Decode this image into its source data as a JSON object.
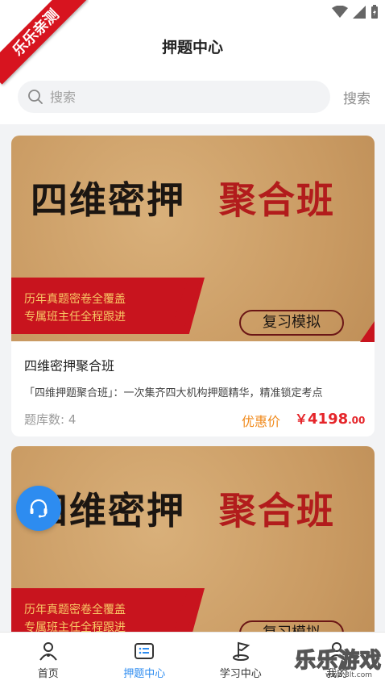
{
  "ribbon": {
    "text": "乐乐亲测"
  },
  "header": {
    "title": "押题中心"
  },
  "search": {
    "placeholder": "搜索",
    "button_label": "搜索"
  },
  "courses": [
    {
      "banner_title_a": "四维密押",
      "banner_title_b": "聚合班",
      "banner_line1": "历年真题密卷全覆盖",
      "banner_line2": "专属班主任全程跟进",
      "banner_button": "复习模拟",
      "title": "四维密押聚合班",
      "description": "「四维押题聚合班」：一次集齐四大机构押题精华，精准锁定考点",
      "count_label": "题库数: 4",
      "price_label": "优惠价",
      "price_symbol": "￥",
      "price_int": "4198",
      "price_dec": ".00"
    },
    {
      "banner_title_a": "四维密押",
      "banner_title_b": "聚合班",
      "banner_line1": "历年真题密卷全覆盖",
      "banner_line2": "专属班主任全程跟进",
      "banner_button": "复习模拟"
    }
  ],
  "tabbar": {
    "items": [
      {
        "label": "首页",
        "icon": "home-icon"
      },
      {
        "label": "押题中心",
        "icon": "list-icon",
        "active": true
      },
      {
        "label": "学习中心",
        "icon": "study-flag-icon"
      },
      {
        "label": "我的",
        "icon": "user-icon"
      }
    ]
  },
  "watermark": {
    "text": "乐乐游戏",
    "url": "www.3lt.com"
  },
  "colors": {
    "accent": "#2d8cf0",
    "price": "#e5252a",
    "price_label": "#f08a1c",
    "ribbon": "#d7141f"
  }
}
